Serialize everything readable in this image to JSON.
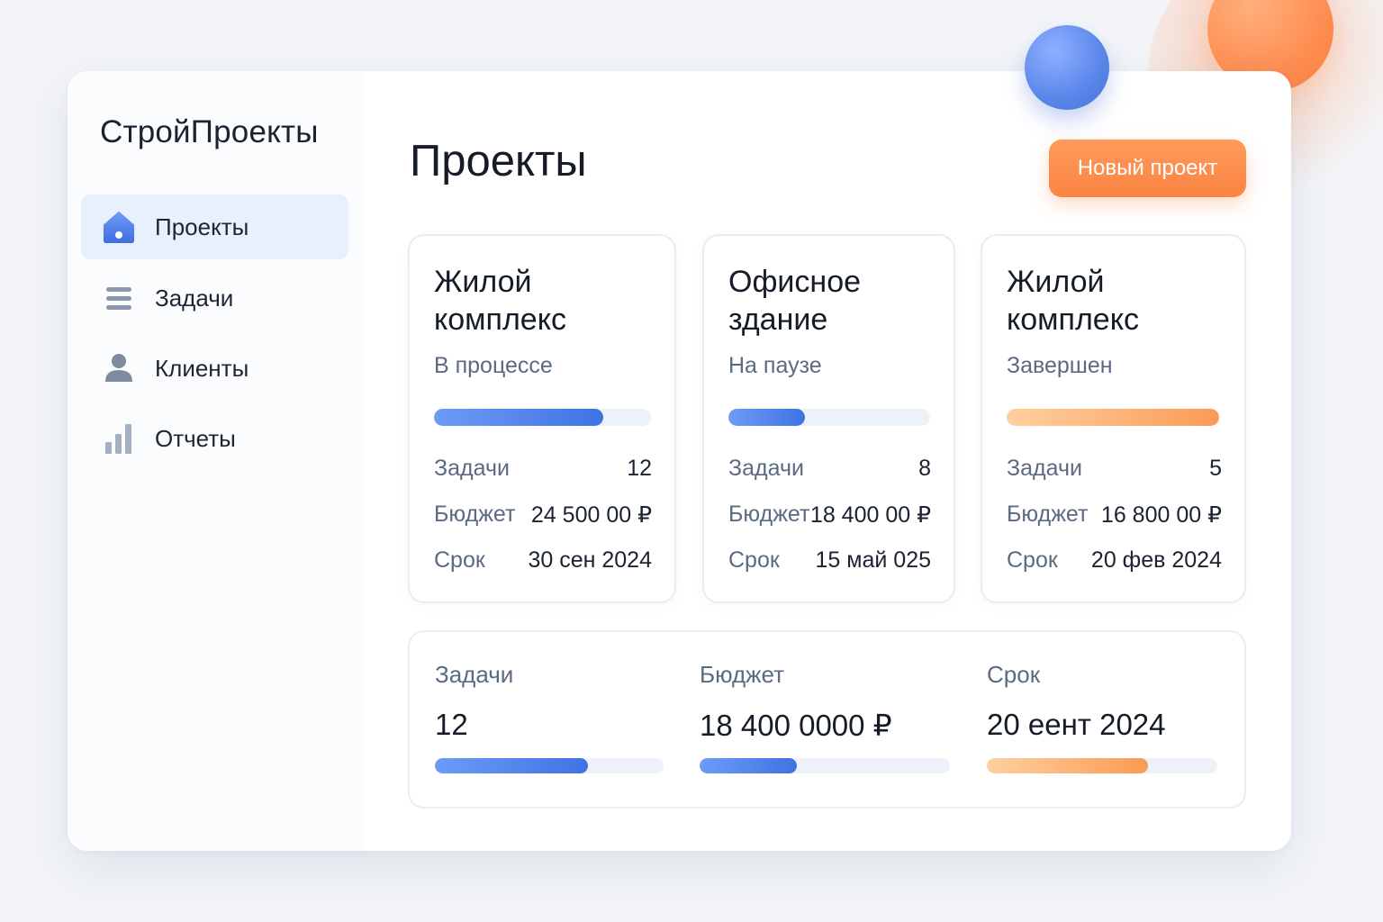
{
  "app": {
    "brand": "СтройПроекты"
  },
  "sidebar": {
    "items": [
      {
        "label": "Проекты",
        "icon": "home-icon",
        "active": true
      },
      {
        "label": "Задачи",
        "icon": "list-icon",
        "active": false
      },
      {
        "label": "Клиенты",
        "icon": "user-icon",
        "active": false
      },
      {
        "label": "Отчеты",
        "icon": "bar-chart-icon",
        "active": false
      }
    ]
  },
  "header": {
    "title": "Проекты",
    "new_button_label": "Новый проект"
  },
  "projects": [
    {
      "title_line1": "Жилой",
      "title_line2": "комплекс",
      "status": "В процессе",
      "progress": 0.78,
      "progress_color": "blue",
      "tasks_label": "Задачи",
      "tasks_value": "12",
      "budget_label": "Бюджет",
      "budget_value": "24 500 00 ₽",
      "deadline_label": "Срок",
      "deadline_value": "30 сен 2024"
    },
    {
      "title_line1": "Офисное",
      "title_line2": "здание",
      "status": "На паузе",
      "progress": 0.38,
      "progress_color": "blue",
      "tasks_label": "Задачи",
      "tasks_value": "8",
      "budget_label": "Бюджет",
      "budget_value": "18 400 00 ₽",
      "deadline_label": "Срок",
      "deadline_value": "15 май 025"
    },
    {
      "title_line1": "Жилой",
      "title_line2": "комплекс",
      "status": "Завершен",
      "progress": 1.0,
      "progress_color": "orange",
      "tasks_label": "Задачи",
      "tasks_value": "5",
      "budget_label": "Бюджет",
      "budget_value": "16 800 00 ₽",
      "deadline_label": "Срок",
      "deadline_value": "20 фев 2024"
    }
  ],
  "summary": {
    "tasks_label": "Задачи",
    "tasks_value": "12",
    "tasks_progress": 0.67,
    "budget_label": "Бюджет",
    "budget_value": "18 400 0000 ₽",
    "budget_progress": 0.39,
    "deadline_label": "Срок",
    "deadline_value": "20 еент 2024",
    "deadline_progress": 0.7
  },
  "colors": {
    "accent_blue": "#3f73e3",
    "accent_orange": "#fb8442"
  }
}
